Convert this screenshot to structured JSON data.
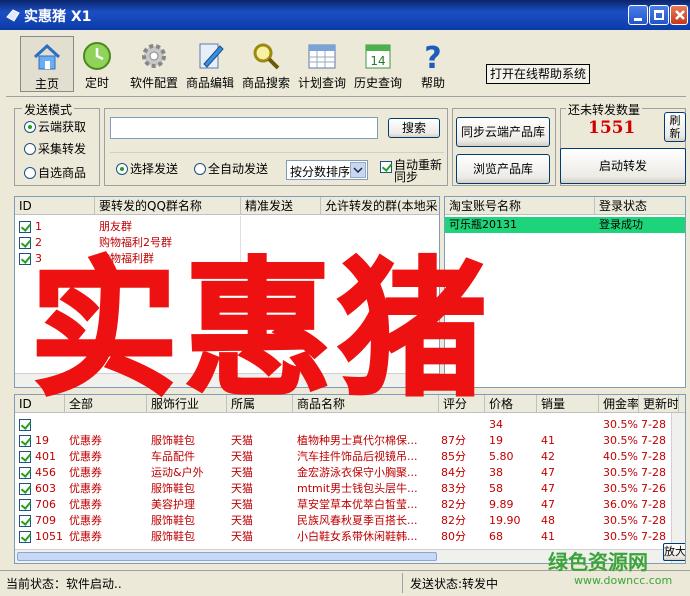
{
  "window": {
    "title": "实惠猪 X1"
  },
  "toolbar": {
    "items": [
      {
        "label": "主页",
        "icon": "home-icon"
      },
      {
        "label": "定时",
        "icon": "clock-icon"
      },
      {
        "label": "软件配置",
        "icon": "gear-icon"
      },
      {
        "label": "商品编辑",
        "icon": "pencil-icon"
      },
      {
        "label": "商品搜索",
        "icon": "magnifier-icon"
      },
      {
        "label": "计划查询",
        "icon": "calendar-grid-icon"
      },
      {
        "label": "历史查询",
        "icon": "calendar-14-icon"
      },
      {
        "label": "帮助",
        "icon": "question-icon"
      }
    ],
    "calendar_day": "14",
    "help_online": "打开在线帮助系统"
  },
  "send_mode": {
    "title": "发送模式",
    "options": [
      "云端获取",
      "采集转发",
      "自选商品"
    ],
    "selected": 0
  },
  "search": {
    "value": "",
    "button": "搜索"
  },
  "send_options": {
    "select_send": "选择发送",
    "auto_send": "全自动发送",
    "sort_value": "按分数排序",
    "auto_resync": "自动重新同步"
  },
  "sync_buttons": {
    "sync_cloud": "同步云端产品库",
    "browse": "浏览产品库"
  },
  "unsent": {
    "title": "还未转发数量",
    "count": "1551",
    "refresh": "刷新",
    "start": "启动转发"
  },
  "groups_grid": {
    "columns": [
      "ID",
      "要转发的QQ群名称",
      "精准发送",
      "允许转发的群(本地采"
    ],
    "rows": [
      {
        "id": "1",
        "name": "朋友群"
      },
      {
        "id": "2",
        "name": "购物福利2号群"
      },
      {
        "id": "3",
        "name": "购物福利群"
      }
    ]
  },
  "accounts_grid": {
    "columns": [
      "淘宝账号名称",
      "登录状态"
    ],
    "rows": [
      {
        "name": "可乐瓶20131",
        "status": "登录成功"
      }
    ]
  },
  "products_grid": {
    "columns": [
      "ID",
      "全部",
      "服饰行业",
      "所属",
      "商品名称",
      "评分",
      "价格",
      "销量",
      "佣金率",
      "更新时"
    ],
    "rows": [
      {
        "id": "",
        "type": "",
        "cat": "",
        "shop": "",
        "name": "",
        "score": "",
        "price": "34",
        "sales": "",
        "rate": "30.5%",
        "date": "7-28"
      },
      {
        "id": "19",
        "type": "优惠券",
        "cat": "服饰鞋包",
        "shop": "天猫",
        "name": "植物种男士真代尔棉保...",
        "score": "87分",
        "price": "19",
        "sales": "41",
        "rate": "30.5%",
        "date": "7-28"
      },
      {
        "id": "401",
        "type": "优惠券",
        "cat": "车品配件",
        "shop": "天猫",
        "name": "汽车挂件饰品后视镜吊...",
        "score": "85分",
        "price": "5.80",
        "sales": "42",
        "rate": "40.5%",
        "date": "7-28"
      },
      {
        "id": "456",
        "type": "优惠券",
        "cat": "运动&户外",
        "shop": "天猫",
        "name": "金宏游泳衣保守小胸聚...",
        "score": "84分",
        "price": "38",
        "sales": "47",
        "rate": "30.5%",
        "date": "7-28"
      },
      {
        "id": "603",
        "type": "优惠券",
        "cat": "服饰鞋包",
        "shop": "天猫",
        "name": "mtmit男士钱包头层牛...",
        "score": "83分",
        "price": "58",
        "sales": "47",
        "rate": "30.5%",
        "date": "7-26"
      },
      {
        "id": "706",
        "type": "优惠券",
        "cat": "美容护理",
        "shop": "天猫",
        "name": "草安堂草本优萃白皙莹...",
        "score": "82分",
        "price": "9.89",
        "sales": "47",
        "rate": "36.0%",
        "date": "7-28"
      },
      {
        "id": "709",
        "type": "优惠券",
        "cat": "服饰鞋包",
        "shop": "天猫",
        "name": "民族风春秋夏季百搭长...",
        "score": "82分",
        "price": "19.90",
        "sales": "48",
        "rate": "30.5%",
        "date": "7-28"
      },
      {
        "id": "1051",
        "type": "优惠券",
        "cat": "服饰鞋包",
        "shop": "天猫",
        "name": "小白鞋女系带休闲鞋韩...",
        "score": "80分",
        "price": "68",
        "sales": "41",
        "rate": "30.5%",
        "date": "7-28"
      }
    ],
    "enlarge": "放大"
  },
  "status": {
    "current": "当前状态：软件启动..",
    "send": "发送状态:转发中"
  },
  "watermark": {
    "big": "实惠猪",
    "site": "绿色资源网",
    "url": "www.downcc.com"
  },
  "colors": {
    "title_bar": "#1c4fc4",
    "accent_red": "#c00000",
    "login_ok": "#00cc66",
    "watermark_red": "#ee1111"
  }
}
